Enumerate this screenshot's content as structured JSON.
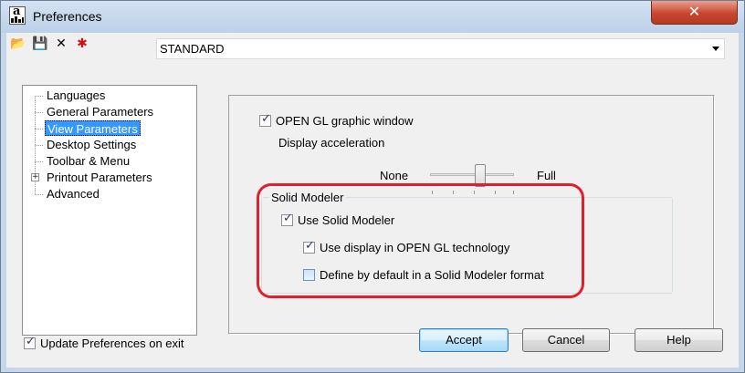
{
  "window": {
    "title": "Preferences",
    "app_icon_letter": "a",
    "close_glyph": "✕"
  },
  "toolbar": {
    "icons": [
      "open-folder-icon",
      "save-icon",
      "delete-icon",
      "new-star-icon"
    ],
    "open_glyph": "📂",
    "save_glyph": "💾",
    "delete_glyph": "✕",
    "new_glyph": "✱"
  },
  "profile": {
    "selected": "STANDARD"
  },
  "tree": {
    "items": [
      {
        "label": "Languages"
      },
      {
        "label": "General Parameters"
      },
      {
        "label": "View Parameters",
        "selected": true
      },
      {
        "label": "Desktop Settings"
      },
      {
        "label": "Toolbar & Menu"
      },
      {
        "label": "Printout Parameters",
        "expandable": true,
        "expander": "+"
      },
      {
        "label": "Advanced"
      }
    ]
  },
  "view_panel": {
    "opengl_label": "OPEN GL graphic window",
    "opengl_checked": true,
    "accel_label": "Display acceleration",
    "slider_min_label": "None",
    "slider_max_label": "Full",
    "slider_level": 0.6
  },
  "solid_modeler": {
    "group_title": "Solid Modeler",
    "use_label": "Use Solid Modeler",
    "use_checked": true,
    "display_label": "Use display in OPEN GL technology",
    "display_checked": true,
    "define_label": "Define by default in a Solid Modeler format",
    "define_checked": false
  },
  "footer": {
    "update_label": "Update Preferences on exit",
    "update_checked": true,
    "accept_label": "Accept",
    "cancel_label": "Cancel",
    "help_label": "Help"
  },
  "colors": {
    "selection": "#3399ff",
    "highlight_ring": "#e0202a",
    "close_button": "#c8452e"
  }
}
